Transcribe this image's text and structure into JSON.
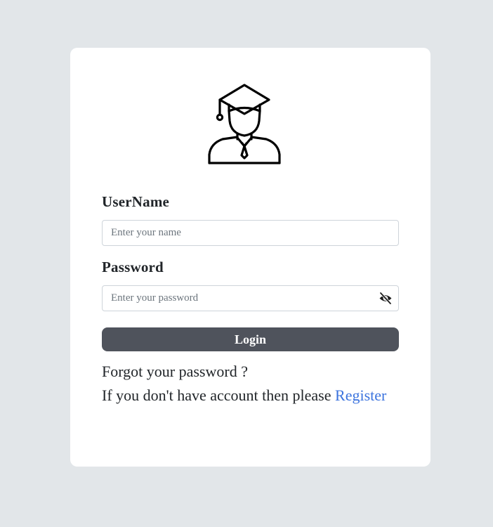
{
  "logo": {
    "icon": "graduate-user-icon"
  },
  "form": {
    "username_label": "UserName",
    "username_placeholder": "Enter your name",
    "username_value": "",
    "password_label": "Password",
    "password_placeholder": "Enter your password",
    "password_value": "",
    "password_toggle_icon": "eye-slash-icon",
    "login_label": "Login"
  },
  "links": {
    "forgot_text": "Forgot your password ?",
    "register_prompt": "If you don't have account then please ",
    "register_label": "Register"
  },
  "colors": {
    "background": "#e2e6e9",
    "card": "#ffffff",
    "button": "#4f535c",
    "link": "#3b73de"
  }
}
